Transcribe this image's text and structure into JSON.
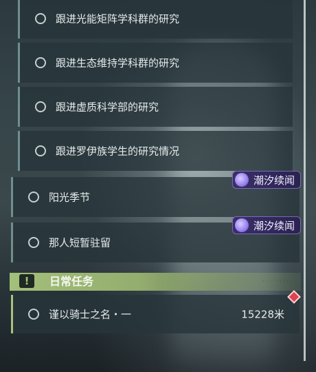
{
  "quests": {
    "sub": [
      {
        "label": "跟进光能矩阵学科群的研究"
      },
      {
        "label": "跟进生态维持学科群的研究"
      },
      {
        "label": "跟进虚质科学部的研究"
      },
      {
        "label": "跟进罗伊族学生的研究情况"
      }
    ],
    "main": [
      {
        "label": "阳光季节",
        "tag": "潮汐续闻"
      },
      {
        "label": "那人短暂驻留",
        "tag": "潮汐续闻"
      }
    ]
  },
  "daily_section": {
    "title": "日常任务",
    "icon": "exclamation-icon",
    "items": [
      {
        "label": "谨以骑士之名・一",
        "distance": "15228米"
      }
    ]
  },
  "colors": {
    "daily_accent": "#a3c07a",
    "tag_bg": "#3a2f6a",
    "card_bg": "#26343a"
  }
}
